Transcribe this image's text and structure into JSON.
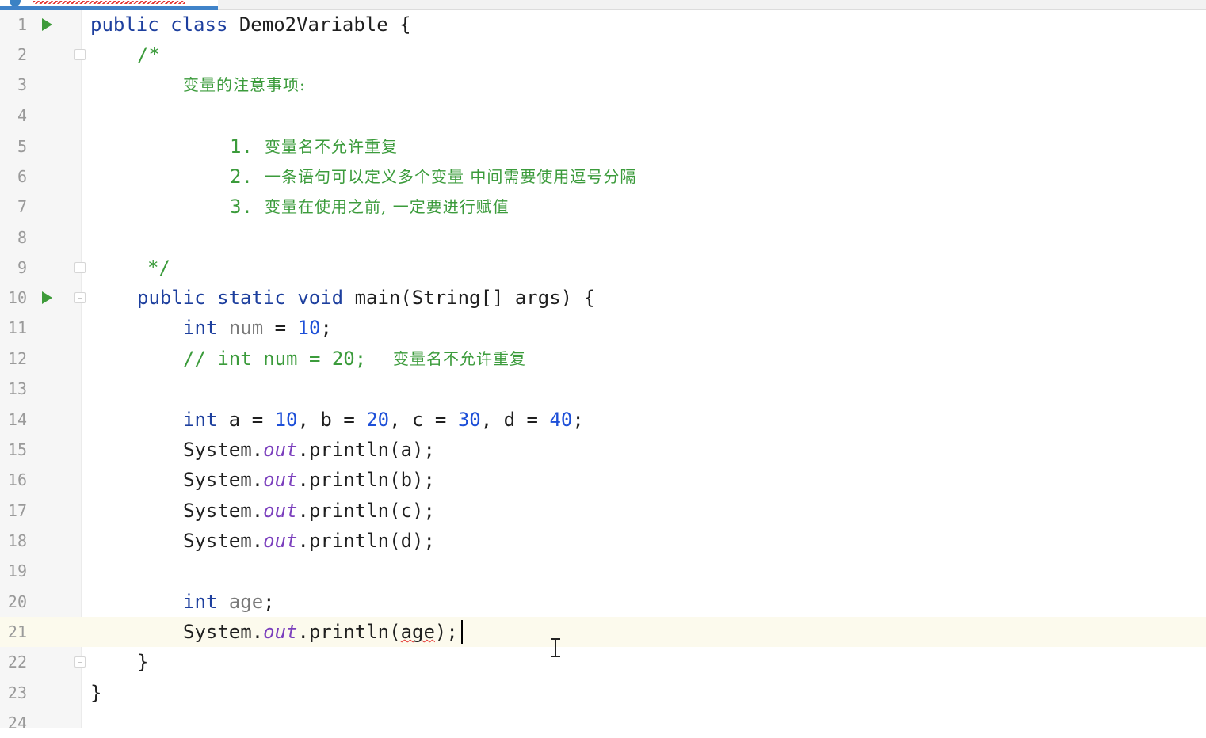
{
  "editor": {
    "class_decl": {
      "kw1": "public",
      "kw2": "class",
      "name": "Demo2Variable",
      "brace": "{"
    },
    "comment_open": "/*",
    "comment_title": "变量的注意事项:",
    "rule1_num": "1.",
    "rule1_text": "变量名不允许重复",
    "rule2_num": "2.",
    "rule2_text": "一条语句可以定义多个变量 中间需要使用逗号分隔",
    "rule3_num": "3.",
    "rule3_text": "变量在使用之前, 一定要进行赋值",
    "comment_close": "*/",
    "main_decl": {
      "kw1": "public",
      "kw2": "static",
      "kw3": "void",
      "sig": "main(String[] args) {"
    },
    "l11": {
      "kw": "int",
      "name": "num",
      "op": " = ",
      "val": "10",
      "end": ";"
    },
    "l12": {
      "code": "// int num = 20;",
      "note": "变量名不允许重复"
    },
    "l14": {
      "kw": "int",
      "a": " a = ",
      "va": "10",
      "b": ", b = ",
      "vb": "20",
      "c": ", c = ",
      "vc": "30",
      "d": ", d = ",
      "vd": "40",
      "end": ";"
    },
    "println": {
      "system": "System.",
      "out": "out",
      "call": ".println("
    },
    "l15_arg": "a);",
    "l16_arg": "b);",
    "l17_arg": "c);",
    "l18_arg": "d);",
    "l20": {
      "kw": "int",
      "name": "age",
      "end": ";"
    },
    "l21": {
      "arg": "age",
      "end": ");"
    },
    "close_method": "}",
    "close_class": "}",
    "line_numbers": [
      "1",
      "2",
      "3",
      "4",
      "5",
      "6",
      "7",
      "8",
      "9",
      "10",
      "11",
      "12",
      "13",
      "14",
      "15",
      "16",
      "17",
      "18",
      "19",
      "20",
      "21",
      "22",
      "23",
      "24"
    ],
    "current_line": 21
  },
  "colors": {
    "keyword": "#1d3f9e",
    "number": "#1d4fd8",
    "comment": "#3b9b3b",
    "static_field": "#7b3fbd",
    "run_icon": "#3e9b3a",
    "current_line_bg": "#fcfaed"
  },
  "icons": {
    "run": "run-gutter-icon",
    "fold": "fold-marker-icon",
    "mouse": "i-beam-cursor-icon"
  }
}
